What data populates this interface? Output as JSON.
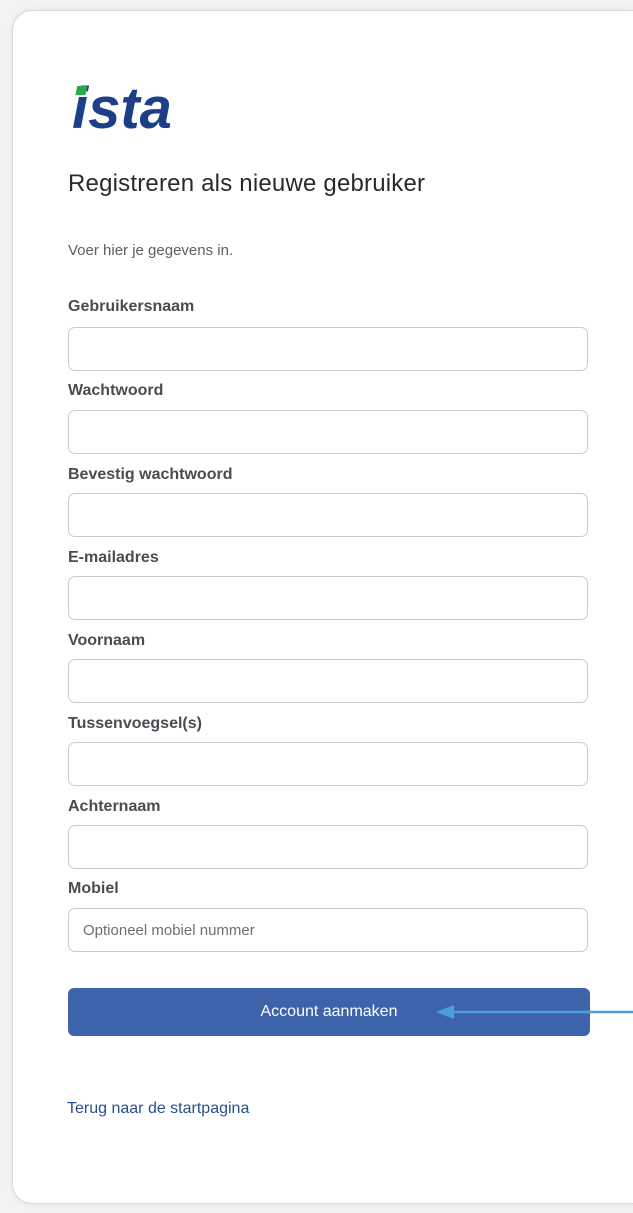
{
  "brand": {
    "logo_text": "ista",
    "logo_color": "#1d3f8a",
    "logo_dot_color": "#2aa84a"
  },
  "header": {
    "title": "Registreren als nieuwe gebruiker",
    "subtitle": "Voer hier je gegevens in."
  },
  "form": {
    "fields": [
      {
        "label": "Gebruikersnaam",
        "value": "",
        "placeholder": ""
      },
      {
        "label": "Wachtwoord",
        "value": "",
        "placeholder": ""
      },
      {
        "label": "Bevestig wachtwoord",
        "value": "",
        "placeholder": ""
      },
      {
        "label": "E-mailadres",
        "value": "",
        "placeholder": ""
      },
      {
        "label": "Voornaam",
        "value": "",
        "placeholder": ""
      },
      {
        "label": "Tussenvoegsel(s)",
        "value": "",
        "placeholder": ""
      },
      {
        "label": "Achternaam",
        "value": "",
        "placeholder": ""
      },
      {
        "label": "Mobiel",
        "value": "",
        "placeholder": "Optioneel mobiel nummer"
      }
    ],
    "submit_label": "Account aanmaken",
    "submit_color": "#3d64aa"
  },
  "annotation": {
    "arrow_icon": "arrow-left-icon",
    "arrow_color": "#4a9fd8"
  },
  "footer": {
    "back_link": "Terug naar de startpagina"
  }
}
